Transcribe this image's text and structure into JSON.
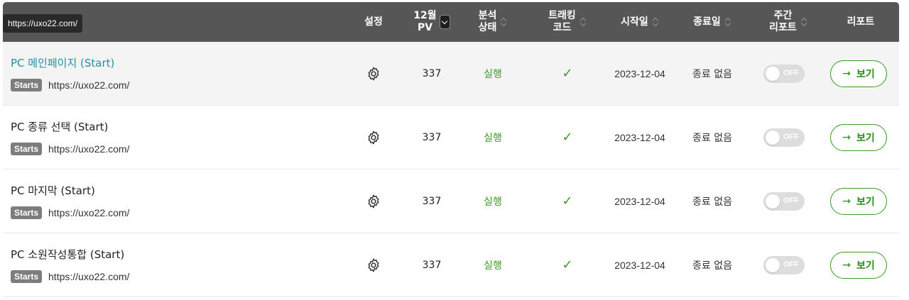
{
  "tooltip": "https://uxo22.com/",
  "header": {
    "settings": "설정",
    "pv_line1": "12월",
    "pv_line2": "PV",
    "analysis_line1": "분석",
    "analysis_line2": "상태",
    "tracking_line1": "트래킹",
    "tracking_line2": "코드",
    "start_date": "시작일",
    "end_date": "종료일",
    "weekly_line1": "주간",
    "weekly_line2": "리포트",
    "report": "리포트"
  },
  "rows": [
    {
      "name": "PC 메인페이지 (Start)",
      "badge": "Starts",
      "url": "https://uxo22.com/",
      "pv": "337",
      "status": "실행",
      "check": "✓",
      "start": "2023-12-04",
      "end": "종료 없음",
      "toggle": "OFF",
      "arrow": "→",
      "button": "보기"
    },
    {
      "name": "PC 종류 선택 (Start)",
      "badge": "Starts",
      "url": "https://uxo22.com/",
      "pv": "337",
      "status": "실행",
      "check": "✓",
      "start": "2023-12-04",
      "end": "종료 없음",
      "toggle": "OFF",
      "arrow": "→",
      "button": "보기"
    },
    {
      "name": "PC 마지막 (Start)",
      "badge": "Starts",
      "url": "https://uxo22.com/",
      "pv": "337",
      "status": "실행",
      "check": "✓",
      "start": "2023-12-04",
      "end": "종료 없음",
      "toggle": "OFF",
      "arrow": "→",
      "button": "보기"
    },
    {
      "name": "PC 소원작성통합 (Start)",
      "badge": "Starts",
      "url": "https://uxo22.com/",
      "pv": "337",
      "status": "실행",
      "check": "✓",
      "start": "2023-12-04",
      "end": "종료 없음",
      "toggle": "OFF",
      "arrow": "→",
      "button": "보기"
    }
  ],
  "icons": {
    "settings": "gear-icon",
    "tracking": "check-icon",
    "report": "arrow-right-icon"
  },
  "colors": {
    "header_bg": "#565656",
    "accent_green": "#3a9a22",
    "active_name": "#23919f",
    "badge_bg": "#7d7d7d",
    "toggle_off": "#dddddd"
  }
}
